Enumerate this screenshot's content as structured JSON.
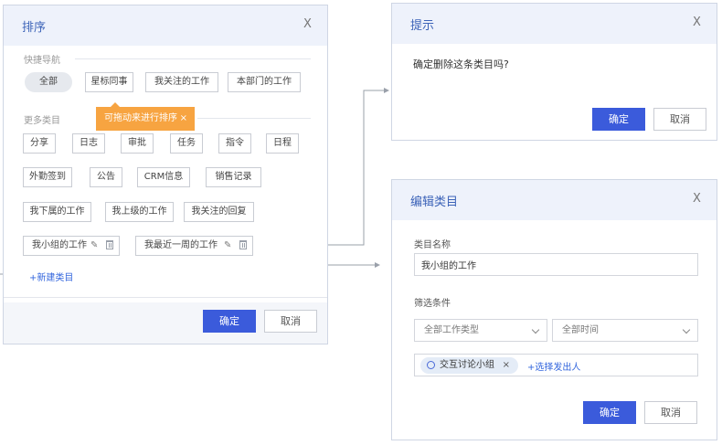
{
  "sort_dialog": {
    "title": "排序",
    "close": "X",
    "quick_nav": {
      "label": "快捷导航",
      "items": [
        "全部",
        "星标同事",
        "我关注的工作",
        "本部门的工作"
      ]
    },
    "tooltip": {
      "text": "可拖动来进行排序",
      "close": "×"
    },
    "more": {
      "label": "更多类目",
      "row1": [
        "分享",
        "日志",
        "审批",
        "任务",
        "指令",
        "日程"
      ],
      "row2": [
        "外勤签到",
        "公告",
        "CRM信息",
        "销售记录"
      ],
      "row3": [
        "我下属的工作",
        "我上级的工作",
        "我关注的回复"
      ],
      "row4": [
        "我小组的工作",
        "我最近一周的工作"
      ]
    },
    "add_link": "+新建类目",
    "confirm": "确定",
    "cancel": "取消"
  },
  "confirm_dialog": {
    "title": "提示",
    "close": "X",
    "message": "确定删除这条类目吗?",
    "confirm": "确定",
    "cancel": "取消"
  },
  "edit_dialog": {
    "title": "编辑类目",
    "close": "X",
    "name_label": "类目名称",
    "name_value": "我小组的工作",
    "filter_label": "筛选条件",
    "type_select": "全部工作类型",
    "time_select": "全部时间",
    "chip": "交互讨论小组",
    "chip_close": "×",
    "pick_link": "+选择发出人",
    "confirm": "确定",
    "cancel": "取消"
  },
  "icons": [
    "pencil-icon",
    "trash-icon",
    "circle-icon",
    "chevron-down-icon",
    "close-icon"
  ],
  "colors": {
    "accent": "#3b5bdb",
    "header": "#eef2fb",
    "tooltip": "#f7a441",
    "link": "#3366dd"
  }
}
